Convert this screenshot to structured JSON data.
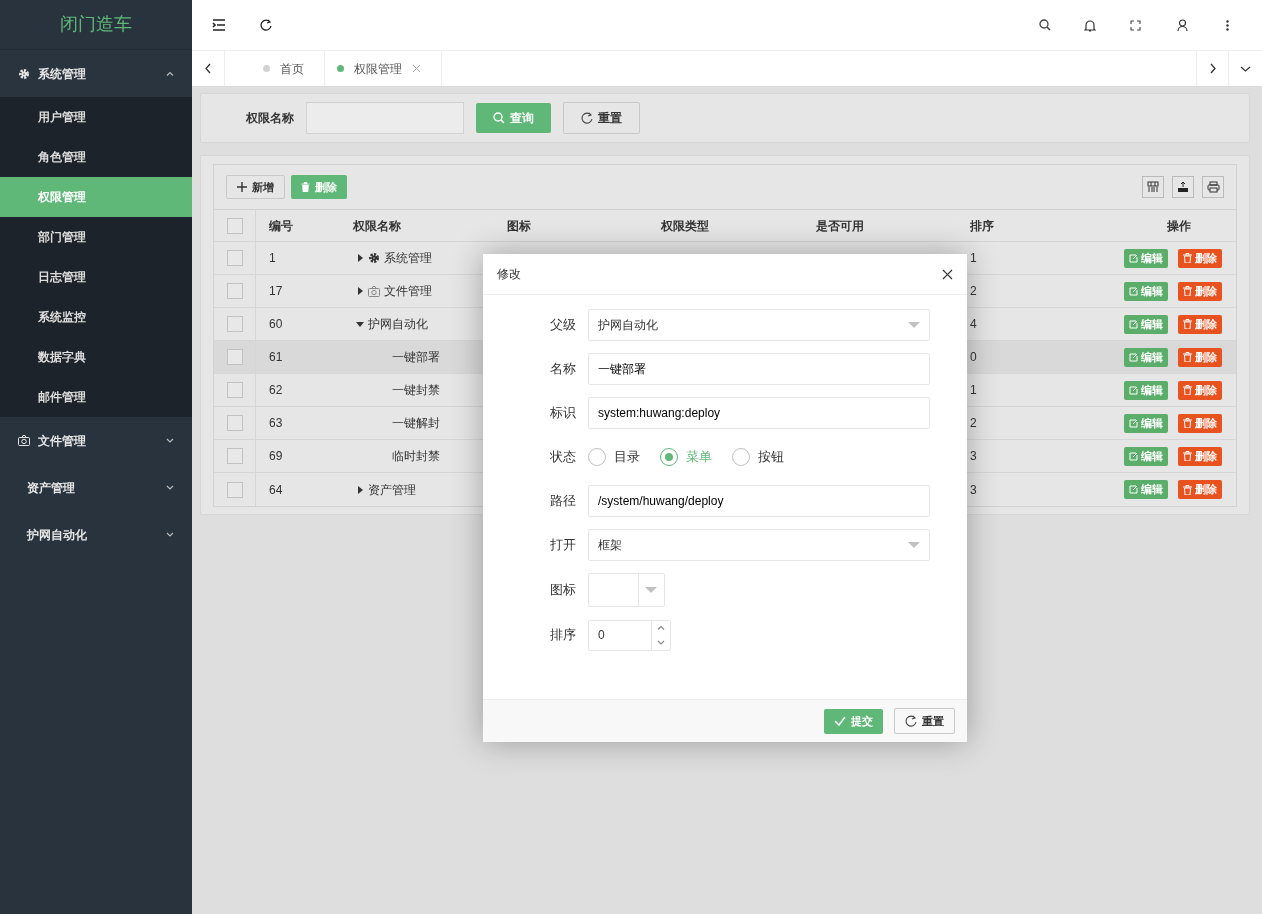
{
  "app": {
    "title": "闭门造车"
  },
  "sidebar": {
    "items": [
      {
        "label": "系统管理",
        "expanded": true,
        "children": [
          {
            "label": "用户管理",
            "selected": false
          },
          {
            "label": "角色管理",
            "selected": false
          },
          {
            "label": "权限管理",
            "selected": true
          },
          {
            "label": "部门管理",
            "selected": false
          },
          {
            "label": "日志管理",
            "selected": false
          },
          {
            "label": "系统监控",
            "selected": false
          },
          {
            "label": "数据字典",
            "selected": false
          },
          {
            "label": "邮件管理",
            "selected": false
          }
        ]
      },
      {
        "label": "文件管理",
        "expanded": false
      },
      {
        "label": "资产管理",
        "expanded": false
      },
      {
        "label": "护网自动化",
        "expanded": false
      }
    ]
  },
  "tabs": [
    {
      "label": "首页",
      "selected": false,
      "closable": false
    },
    {
      "label": "权限管理",
      "selected": true,
      "closable": true
    }
  ],
  "search": {
    "label": "权限名称",
    "buttons": [
      {
        "label": "查询",
        "kind": "primary"
      },
      {
        "label": "重置",
        "kind": "reset"
      }
    ]
  },
  "toolbar": {
    "buttons": [
      {
        "label": "新增",
        "kind": "add"
      },
      {
        "label": "删除",
        "kind": "delete"
      }
    ]
  },
  "table": {
    "select_all_checked": false,
    "columns": [
      "编号",
      "权限名称",
      "图标",
      "权限类型",
      "是否可用",
      "排序",
      "操作"
    ],
    "rows": [
      {
        "id": "1",
        "name": "系统管理",
        "expanded": false,
        "sort": "1",
        "checked": false,
        "hovered": false,
        "actions": [
          "编辑",
          "删除"
        ]
      },
      {
        "id": "17",
        "name": "文件管理",
        "expanded": false,
        "sort": "2",
        "checked": false,
        "hovered": false,
        "actions": [
          "编辑",
          "删除"
        ]
      },
      {
        "id": "60",
        "name": "护网自动化",
        "expanded": true,
        "sort": "4",
        "checked": false,
        "hovered": false,
        "actions": [
          "编辑",
          "删除"
        ],
        "children": [
          {
            "id": "61",
            "name": "一键部署",
            "sort": "0",
            "checked": false,
            "hovered": true,
            "actions": [
              "编辑",
              "删除"
            ]
          },
          {
            "id": "62",
            "name": "一键封禁",
            "sort": "1",
            "checked": false,
            "hovered": false,
            "actions": [
              "编辑",
              "删除"
            ]
          },
          {
            "id": "63",
            "name": "一键解封",
            "sort": "2",
            "checked": false,
            "hovered": false,
            "actions": [
              "编辑",
              "删除"
            ]
          },
          {
            "id": "69",
            "name": "临时封禁",
            "sort": "3",
            "checked": false,
            "hovered": false,
            "actions": [
              "编辑",
              "删除"
            ]
          }
        ]
      },
      {
        "id": "64",
        "name": "资产管理",
        "expanded": false,
        "sort": "3",
        "checked": false,
        "hovered": false,
        "actions": [
          "编辑",
          "删除"
        ]
      }
    ]
  },
  "modal": {
    "title": "修改",
    "fields": [
      {
        "kind": "select",
        "label": "父级",
        "value": "护网自动化"
      },
      {
        "kind": "text",
        "label": "名称",
        "value": "一键部署"
      },
      {
        "kind": "text",
        "label": "标识",
        "value": "system:huwang:deploy"
      },
      {
        "kind": "radio",
        "label": "状态",
        "options": [
          {
            "label": "目录",
            "selected": false
          },
          {
            "label": "菜单",
            "selected": true
          },
          {
            "label": "按钮",
            "selected": false
          }
        ]
      },
      {
        "kind": "text",
        "label": "路径",
        "value": "/system/huwang/deploy"
      },
      {
        "kind": "select",
        "label": "打开",
        "value": "框架"
      },
      {
        "kind": "iconpicker",
        "label": "图标"
      },
      {
        "kind": "number",
        "label": "排序",
        "value": "0"
      }
    ],
    "buttons": [
      {
        "label": "提交",
        "kind": "primary"
      },
      {
        "label": "重置",
        "kind": "reset"
      }
    ]
  }
}
